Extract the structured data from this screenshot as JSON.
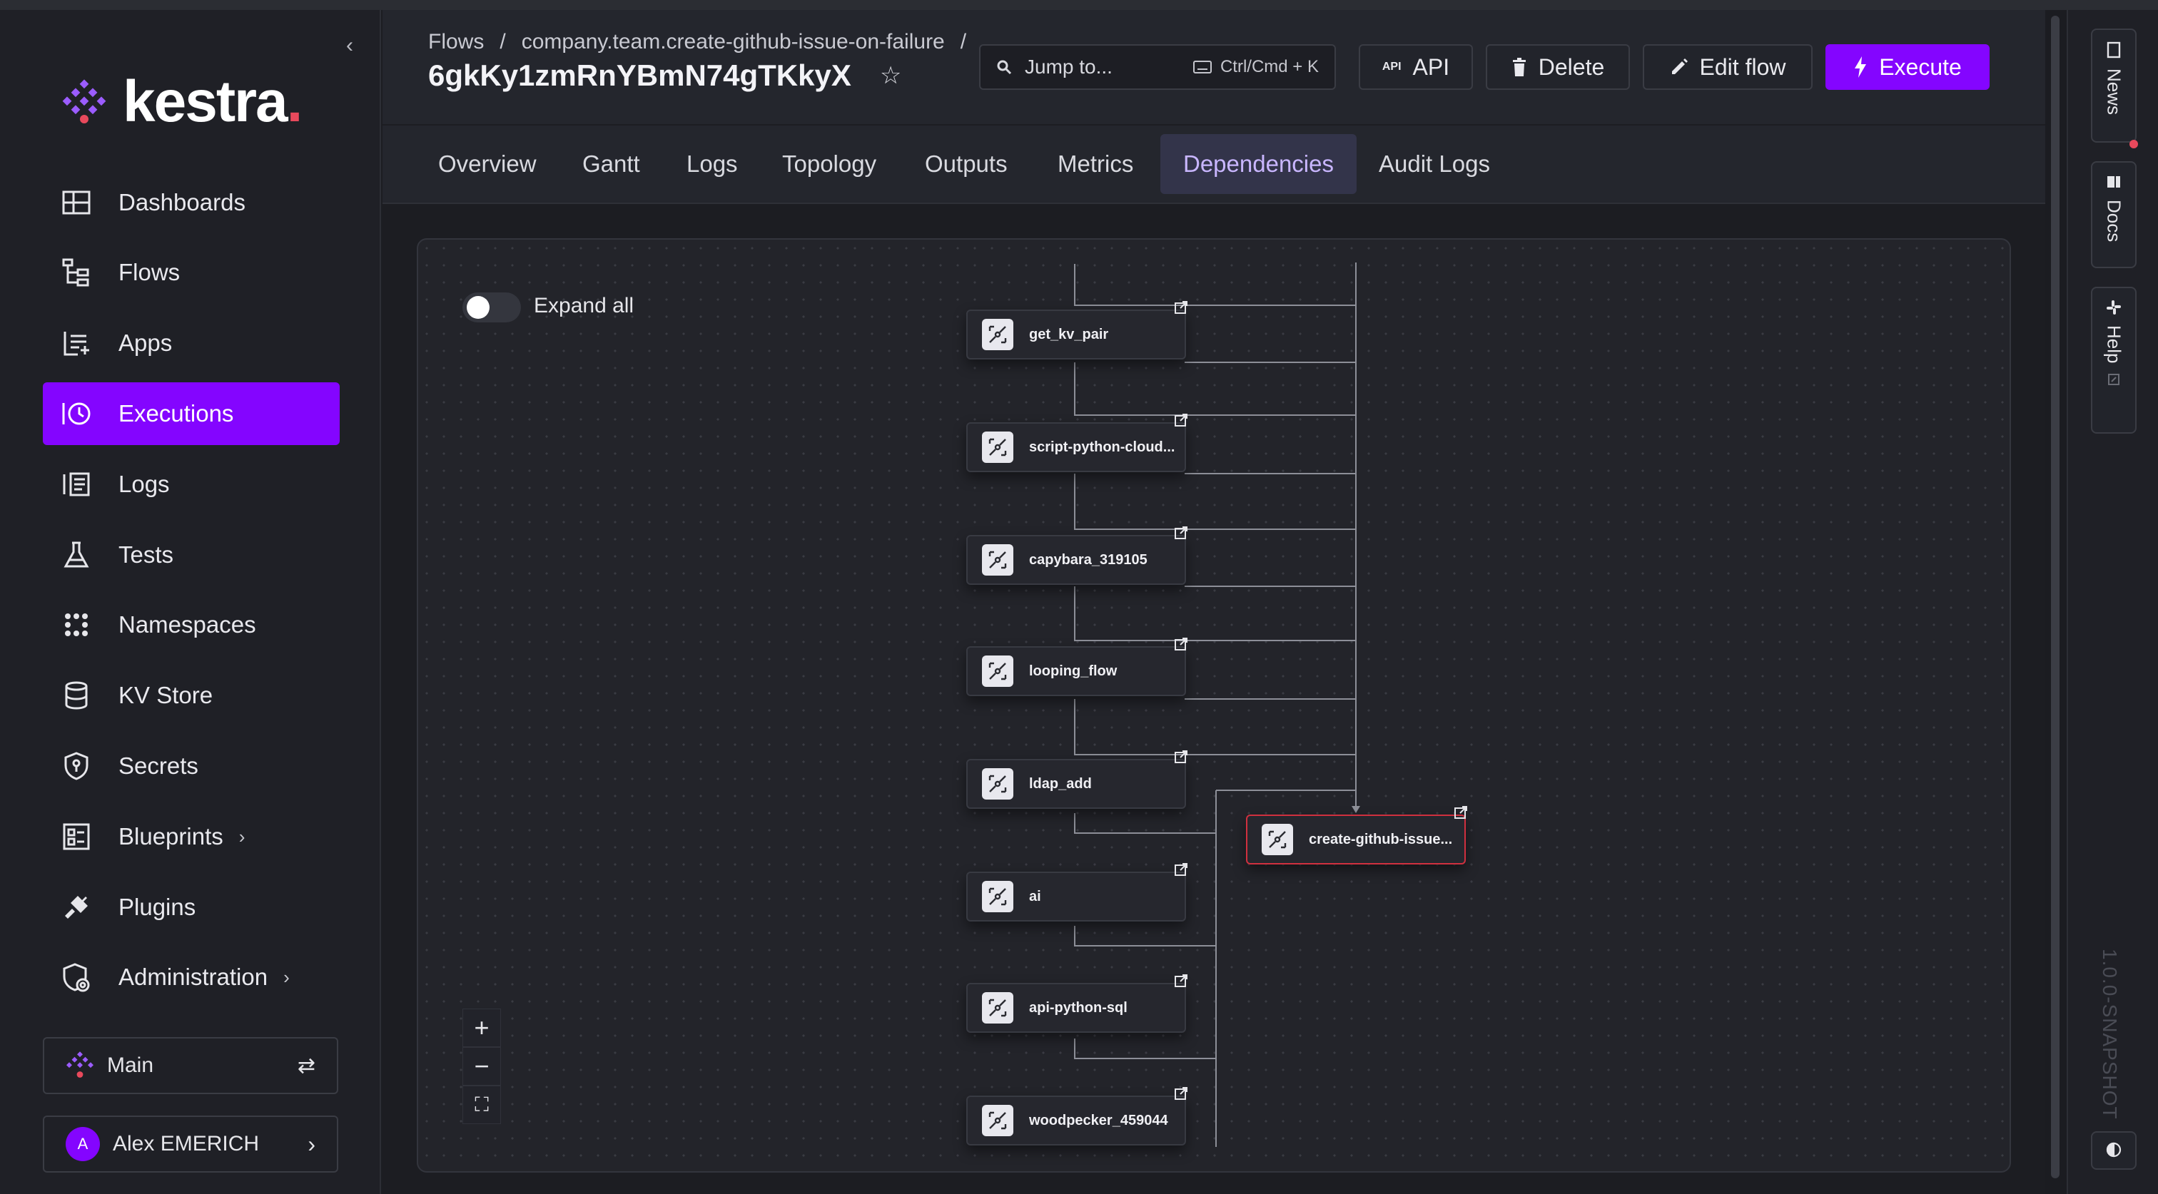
{
  "sidebar": {
    "logo_text": "kestra",
    "logo_dot": ".",
    "items": [
      {
        "label": "Dashboards",
        "icon": "dashboard-icon"
      },
      {
        "label": "Flows",
        "icon": "flows-icon"
      },
      {
        "label": "Apps",
        "icon": "apps-icon"
      },
      {
        "label": "Executions",
        "icon": "executions-icon",
        "active": true
      },
      {
        "label": "Logs",
        "icon": "logs-icon"
      },
      {
        "label": "Tests",
        "icon": "flask-icon"
      },
      {
        "label": "Namespaces",
        "icon": "namespaces-icon"
      },
      {
        "label": "KV Store",
        "icon": "database-icon"
      },
      {
        "label": "Secrets",
        "icon": "shield-key-icon"
      },
      {
        "label": "Blueprints",
        "icon": "blueprints-icon",
        "chevron": "›"
      },
      {
        "label": "Plugins",
        "icon": "plug-icon"
      },
      {
        "label": "Administration",
        "icon": "admin-icon",
        "chevron": "›"
      }
    ],
    "tenant": "Main",
    "user_initial": "A",
    "user_name": "Alex EMERICH",
    "collapse_glyph": "‹"
  },
  "header": {
    "breadcrumb": [
      "Flows",
      "/",
      "company.team.create-github-issue-on-failure",
      "/"
    ],
    "title": "6gkKy1zmRnYBmN74gTKkyX",
    "search_label": "Jump to...",
    "search_shortcut": "Ctrl/Cmd + K",
    "api_badge": "API",
    "api_label": "API",
    "delete_label": "Delete",
    "edit_label": "Edit flow",
    "execute_label": "Execute"
  },
  "tabs": [
    "Overview",
    "Gantt",
    "Logs",
    "Topology",
    "Outputs",
    "Metrics",
    "Dependencies",
    "Audit Logs"
  ],
  "active_tab": "Dependencies",
  "canvas": {
    "expand_all_label": "Expand all",
    "expand_all_on": false,
    "zoom_in": "+",
    "zoom_out": "−",
    "fit": "⛶",
    "nodes": [
      "get_kv_pair",
      "script-python-cloud...",
      "capybara_319105",
      "looping_flow",
      "ldap_add",
      "ai",
      "api-python-sql",
      "woodpecker_459044"
    ],
    "target_node": "create-github-issue..."
  },
  "rail": {
    "news": "News",
    "docs": "Docs",
    "help": "Help",
    "version": "1.0.0-SNAPSHOT"
  },
  "colors": {
    "accent": "#8405ff",
    "danger": "#d0303f",
    "logo_dot": "#e8495c"
  }
}
